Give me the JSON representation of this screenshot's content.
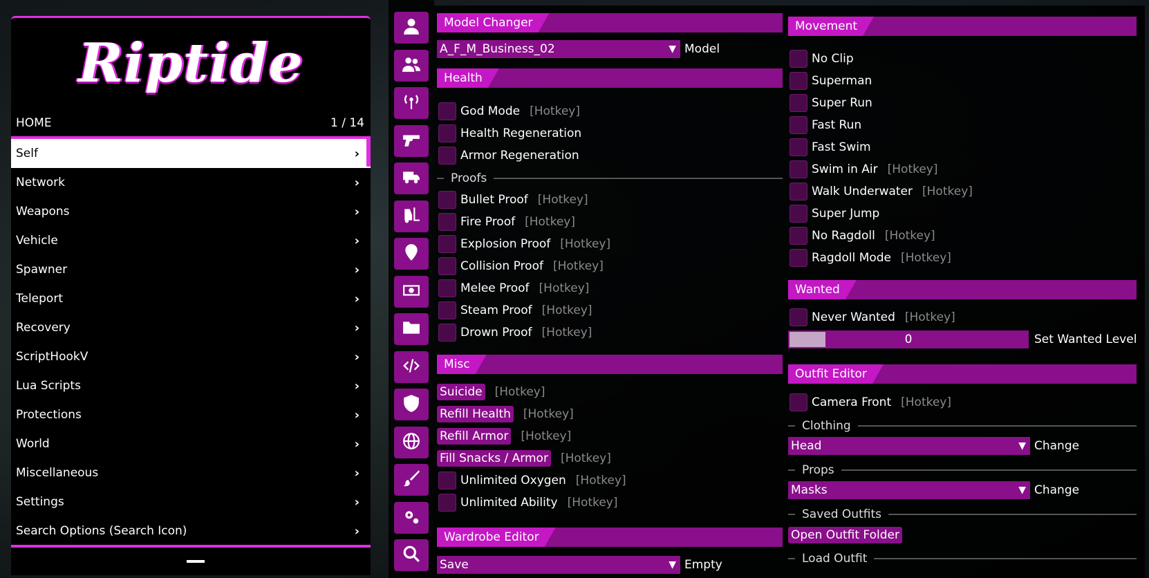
{
  "menu": {
    "logo": "Riptide",
    "breadcrumb": "HOME",
    "page": "1 / 14",
    "items": [
      "Self",
      "Network",
      "Weapons",
      "Vehicle",
      "Spawner",
      "Teleport",
      "Recovery",
      "ScriptHookV",
      "Lua Scripts",
      "Protections",
      "World",
      "Miscellaneous",
      "Settings",
      "Search Options (Search Icon)"
    ]
  },
  "icons": [
    "user-icon",
    "users-icon",
    "broadcast-icon",
    "gun-icon",
    "truck-icon",
    "forklift-icon",
    "location-pin-icon",
    "money-icon",
    "folder-icon",
    "code-icon",
    "shield-icon",
    "globe-icon",
    "paintbrush-icon",
    "gears-icon",
    "search-icon"
  ],
  "hotkey": "[Hotkey]",
  "left": {
    "model_changer": {
      "title": "Model Changer",
      "value": "A_F_M_Business_02",
      "label": "Model"
    },
    "health": {
      "title": "Health",
      "items": [
        {
          "label": "God Mode",
          "hotkey": true
        },
        {
          "label": "Health Regeneration",
          "hotkey": false
        },
        {
          "label": "Armor Regeneration",
          "hotkey": false
        }
      ]
    },
    "proofs": {
      "title": "Proofs",
      "items": [
        "Bullet Proof",
        "Fire Proof",
        "Explosion Proof",
        "Collision Proof",
        "Melee Proof",
        "Steam Proof",
        "Drown Proof"
      ]
    },
    "misc": {
      "title": "Misc",
      "buttons": [
        "Suicide",
        "Refill Health",
        "Refill Armor",
        "Fill Snacks / Armor"
      ],
      "toggles": [
        "Unlimited Oxygen",
        "Unlimited Ability"
      ]
    },
    "wardrobe": {
      "title": "Wardrobe Editor",
      "value": "Save",
      "label": "Empty"
    }
  },
  "right": {
    "movement": {
      "title": "Movement",
      "items": [
        {
          "label": "No Clip",
          "hotkey": false
        },
        {
          "label": "Superman",
          "hotkey": false
        },
        {
          "label": "Super Run",
          "hotkey": false
        },
        {
          "label": "Fast Run",
          "hotkey": false
        },
        {
          "label": "Fast Swim",
          "hotkey": false
        },
        {
          "label": "Swim in Air",
          "hotkey": true
        },
        {
          "label": "Walk Underwater",
          "hotkey": true
        },
        {
          "label": "Super Jump",
          "hotkey": false
        },
        {
          "label": "No Ragdoll",
          "hotkey": true
        },
        {
          "label": "Ragdoll Mode",
          "hotkey": true
        }
      ]
    },
    "wanted": {
      "title": "Wanted",
      "never": "Never Wanted",
      "level": 0,
      "level_fraction": 0.15,
      "level_label": "Set Wanted Level"
    },
    "outfit": {
      "title": "Outfit Editor",
      "camera": "Camera Front",
      "clothing": "Clothing",
      "clothing_value": "Head",
      "change": "Change",
      "props": "Props",
      "props_value": "Masks",
      "saved": "Saved Outfits",
      "open_folder": "Open Outfit Folder",
      "load": "Load Outfit"
    }
  },
  "colors": {
    "accent": "#e12ee1",
    "panel": "#8a0f8a",
    "tab": "#c418c4"
  }
}
